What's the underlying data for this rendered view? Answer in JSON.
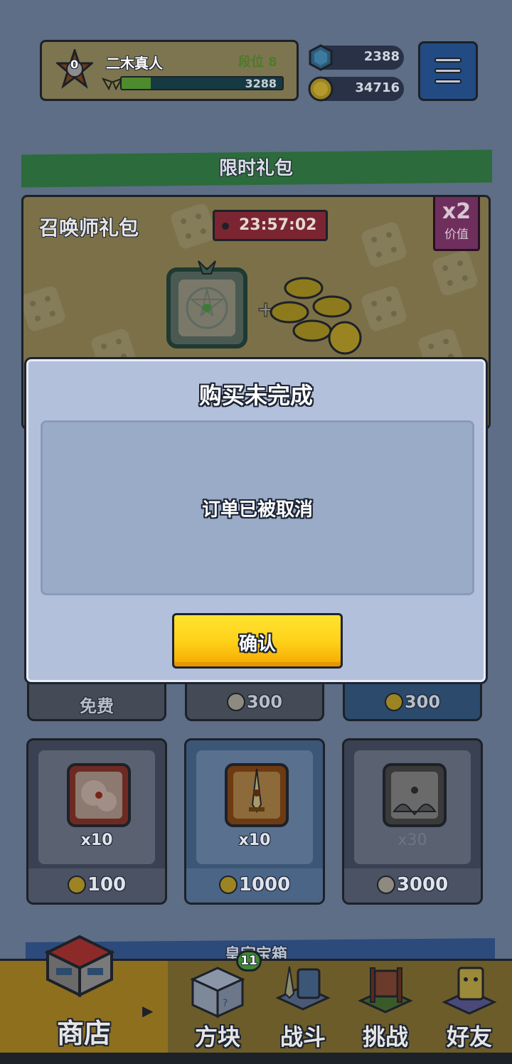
{
  "player": {
    "name": "二木真人",
    "rank_label": "段位 8",
    "rank_number": "0",
    "xp_value": "3288",
    "xp_progress": 0.18
  },
  "currencies": {
    "gems": "2388",
    "coins": "34716"
  },
  "limited_section": {
    "title": "限时礼包"
  },
  "pack": {
    "title": "召唤师礼包",
    "timer": "23:57:02",
    "multiplier": "x2",
    "multiplier_label": "价值"
  },
  "shop_row_top": {
    "prices": [
      "免费",
      "300",
      "300"
    ]
  },
  "shop_row_items": [
    {
      "icon": "cloud-burst-dice-icon",
      "qty": "x10",
      "price": "100"
    },
    {
      "icon": "sword-dice-icon",
      "qty": "x10",
      "price": "1000"
    },
    {
      "icon": "hands-dice-icon",
      "qty": "x30",
      "price": "3000"
    }
  ],
  "chest_section": {
    "title": "皇家宝箱"
  },
  "nav": {
    "items": [
      {
        "label": "商店",
        "icon": "shop-icon"
      },
      {
        "label": "方块",
        "icon": "dice-block-icon",
        "badge": "11"
      },
      {
        "label": "战斗",
        "icon": "sword-shield-icon"
      },
      {
        "label": "挑战",
        "icon": "signboard-icon"
      },
      {
        "label": "好友",
        "icon": "friend-icon"
      }
    ]
  },
  "dialog": {
    "title": "购买未完成",
    "message": "订单已被取消",
    "confirm_label": "确认"
  },
  "colors": {
    "confirm_button": "#ffd21a",
    "dialog_background": "#b3c0dc"
  }
}
